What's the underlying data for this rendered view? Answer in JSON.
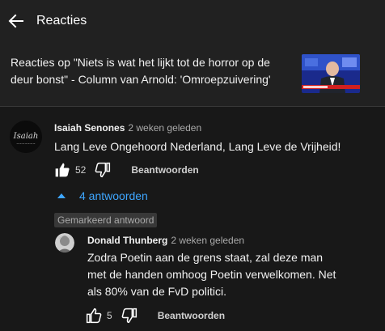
{
  "header": {
    "title": "Reacties"
  },
  "video": {
    "title": "Reacties op \"Niets is wat het lijkt tot de horror op de deur bonst\" - Column van Arnold: 'Omroepzuivering'"
  },
  "comment": {
    "author": "Isaiah Senones",
    "time": "2 weken geleden",
    "text": "Lang Leve Ongehoord Nederland, Lang Leve de Vrijheid!",
    "likes": "52",
    "reply_label": "Beantwoorden",
    "avatar_text": "Isaiah"
  },
  "replies_toggle": {
    "label": "4 antwoorden"
  },
  "highlight_badge": "Gemarkeerd antwoord",
  "reply": {
    "author": "Donald Thunberg",
    "time": "2 weken geleden",
    "text": "Zodra Poetin aan de grens staat, zal deze man met de handen omhoog Poetin verwelkomen. Net als 80% van de FvD politici.",
    "likes": "5",
    "reply_label": "Beantwoorden"
  },
  "icons": {
    "back": "back-arrow-icon",
    "like": "thumbs-up-icon",
    "dislike": "thumbs-down-icon",
    "expand": "caret-up-icon"
  },
  "colors": {
    "link": "#3ea6ff",
    "background": "#181818",
    "panel": "#212121"
  }
}
